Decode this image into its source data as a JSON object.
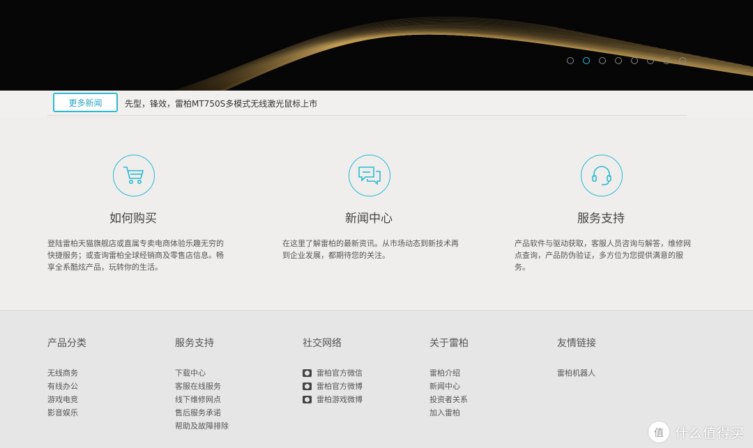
{
  "banner": {
    "dots": [
      {
        "active": false
      },
      {
        "active": true
      },
      {
        "active": false
      },
      {
        "active": false
      },
      {
        "active": false
      },
      {
        "active": false
      },
      {
        "active": false
      },
      {
        "active": false
      }
    ],
    "accent": "#29c3e0"
  },
  "news": {
    "more_label": "更多新闻",
    "headline": "先型，锋效，雷柏MT750S多模式无线激光鼠标上市"
  },
  "features": [
    {
      "icon": "shopping-cart-icon",
      "title": "如何购买",
      "desc": "登陆雷柏天猫旗舰店或直属专卖电商体验乐趣无穷的快捷服务；或查询雷柏全球经销商及零售店信息。畅享全系酷炫产品，玩转你的生活。"
    },
    {
      "icon": "chat-bubbles-icon",
      "title": "新闻中心",
      "desc": "在这里了解雷柏的最新资讯。从市场动态到新技术再到企业发展，都期待您的关注。"
    },
    {
      "icon": "headset-icon",
      "title": "服务支持",
      "desc": "产品软件与驱动获取，客服人员咨询与解答，维修网点查询，产品防伪验证，多方位为您提供满意的服务。"
    }
  ],
  "footer": {
    "columns": [
      {
        "title": "产品分类",
        "items": [
          "无线商务",
          "有线办公",
          "游戏电竞",
          "影音娱乐"
        ]
      },
      {
        "title": "服务支持",
        "items": [
          "下载中心",
          "客服在线服务",
          "线下维修网点",
          "售后服务承诺",
          "帮助及故障排除"
        ]
      },
      {
        "title": "社交网络",
        "items": [
          "雷柏官方微信",
          "雷柏官方微博",
          "雷柏游戏微博"
        ],
        "icons": [
          "wechat-icon",
          "weibo-icon",
          "weibo-icon"
        ]
      },
      {
        "title": "关于雷柏",
        "items": [
          "雷柏介绍",
          "新闻中心",
          "投资者关系",
          "加入雷柏"
        ]
      },
      {
        "title": "友情链接",
        "items": [
          "雷柏机器人"
        ]
      }
    ]
  },
  "watermark": {
    "text": "什么值得买"
  }
}
